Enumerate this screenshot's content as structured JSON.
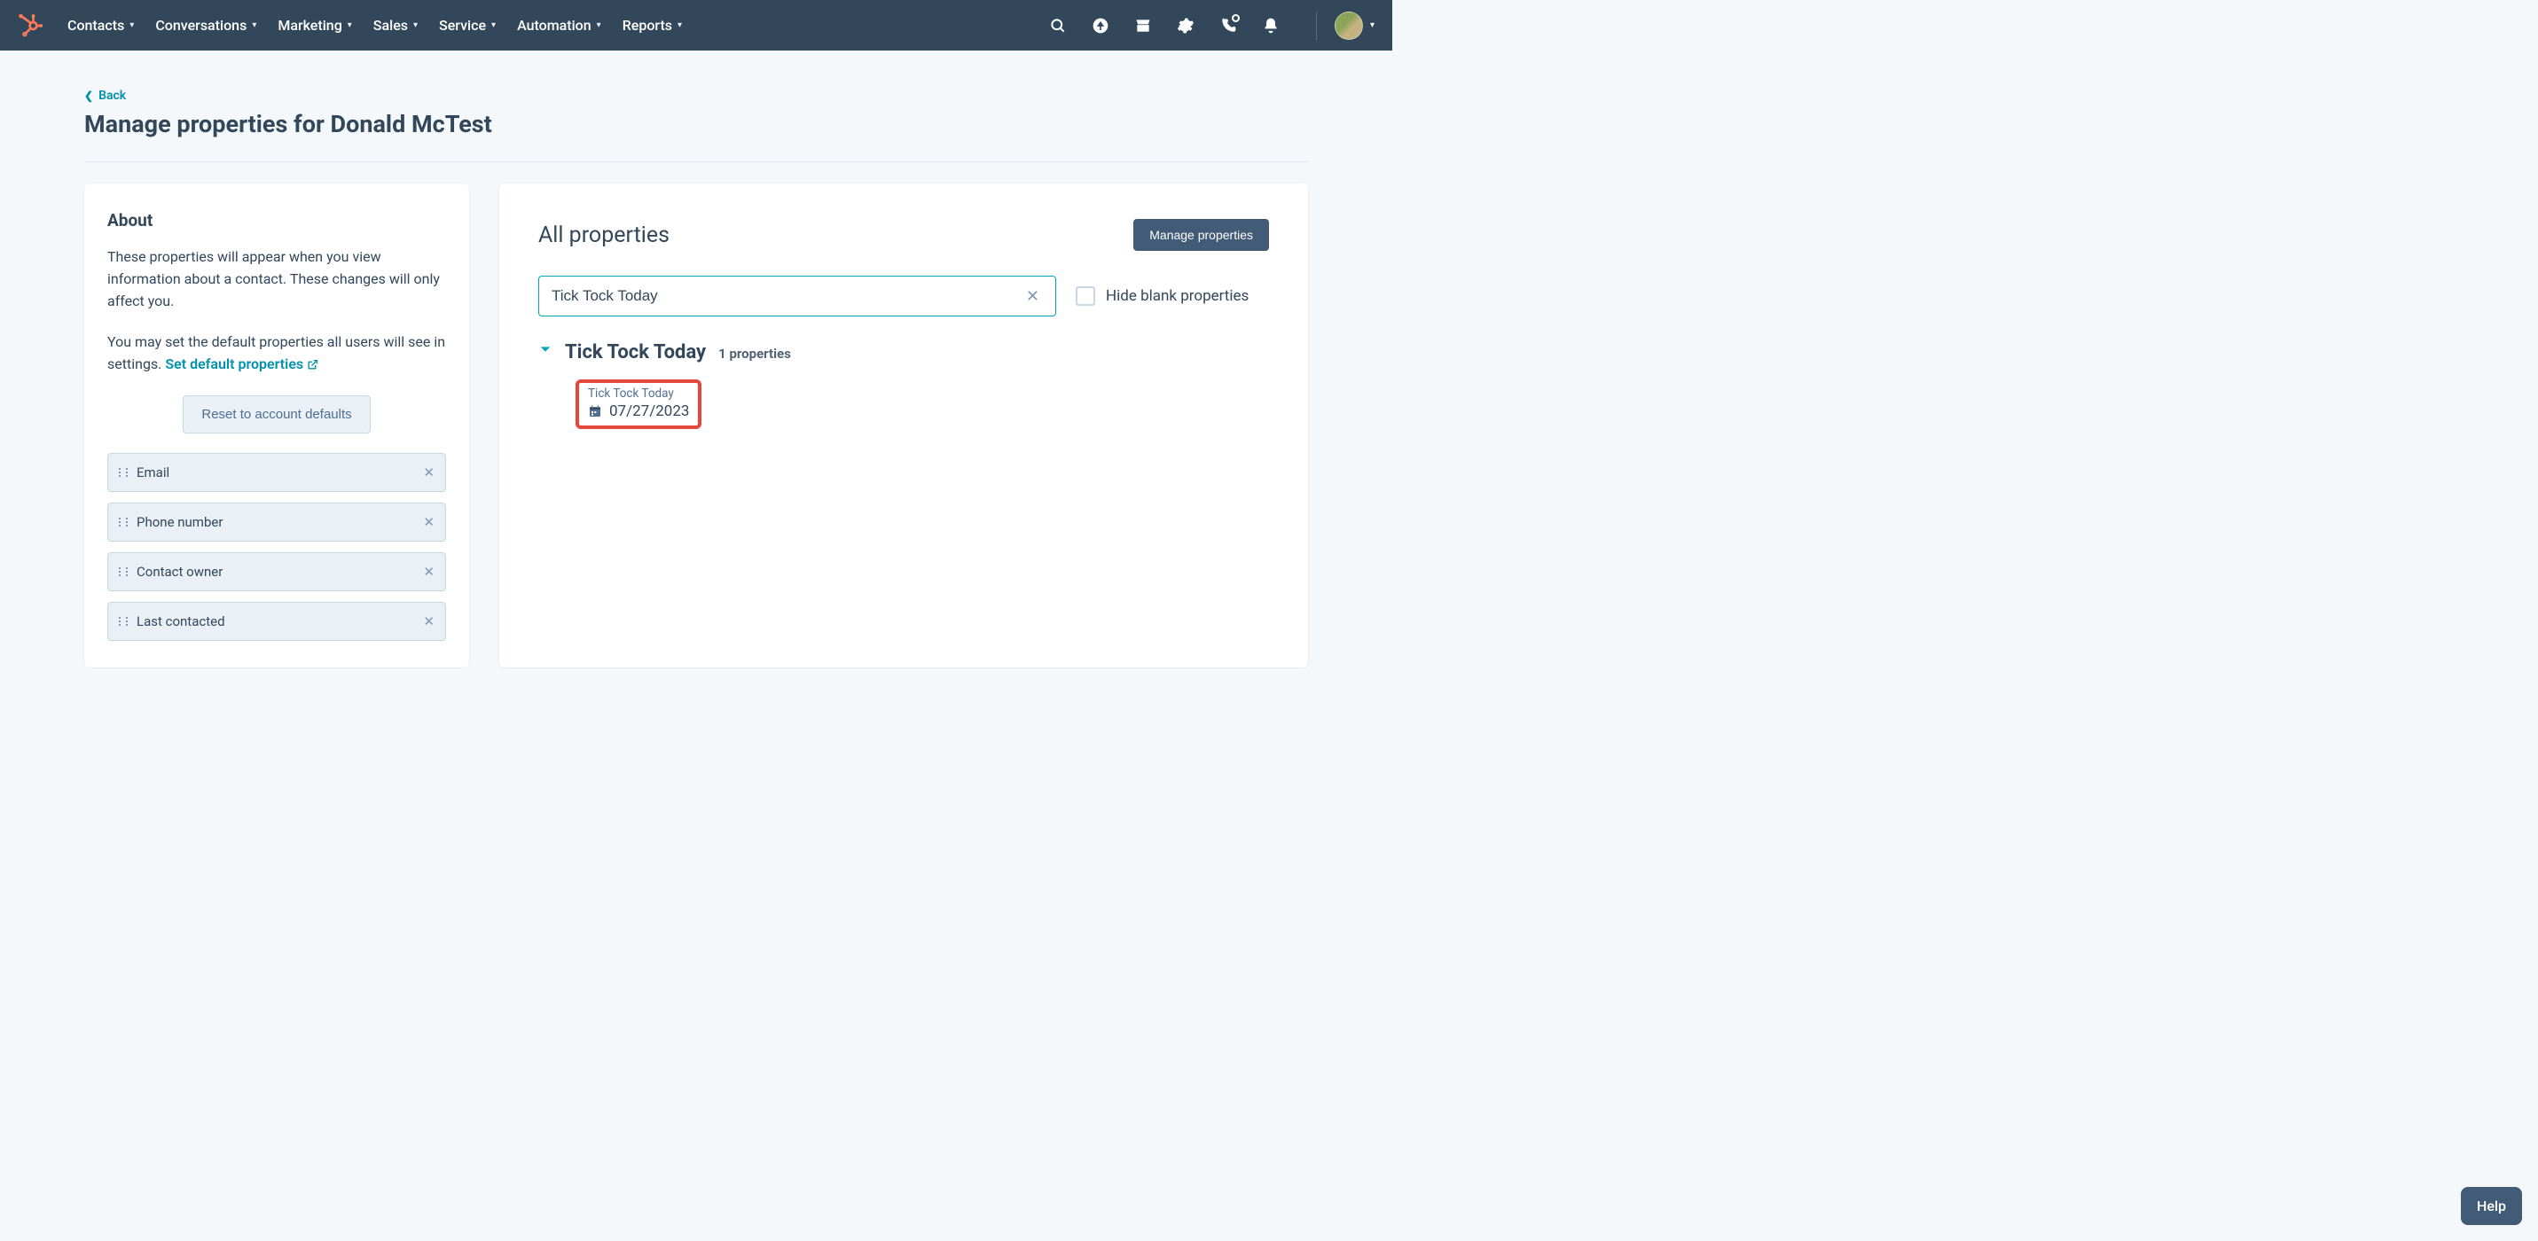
{
  "nav": {
    "items": [
      "Contacts",
      "Conversations",
      "Marketing",
      "Sales",
      "Service",
      "Automation",
      "Reports"
    ]
  },
  "back_label": "Back",
  "page_title": "Manage properties for Donald McTest",
  "about": {
    "heading": "About",
    "para1": "These properties will appear when you view information about a contact. These changes will only affect you.",
    "para2a": "You may set the default properties all users will see in settings. ",
    "link": "Set default properties",
    "reset_btn": "Reset to account defaults",
    "props": [
      "Email",
      "Phone number",
      "Contact owner",
      "Last contacted"
    ]
  },
  "right": {
    "title": "All properties",
    "manage_btn": "Manage properties",
    "search_value": "Tick Tock Today",
    "hide_blank": "Hide blank properties",
    "group_name": "Tick Tock Today",
    "group_count": "1 properties",
    "prop_label": "Tick Tock Today",
    "prop_value": "07/27/2023"
  },
  "help": "Help"
}
